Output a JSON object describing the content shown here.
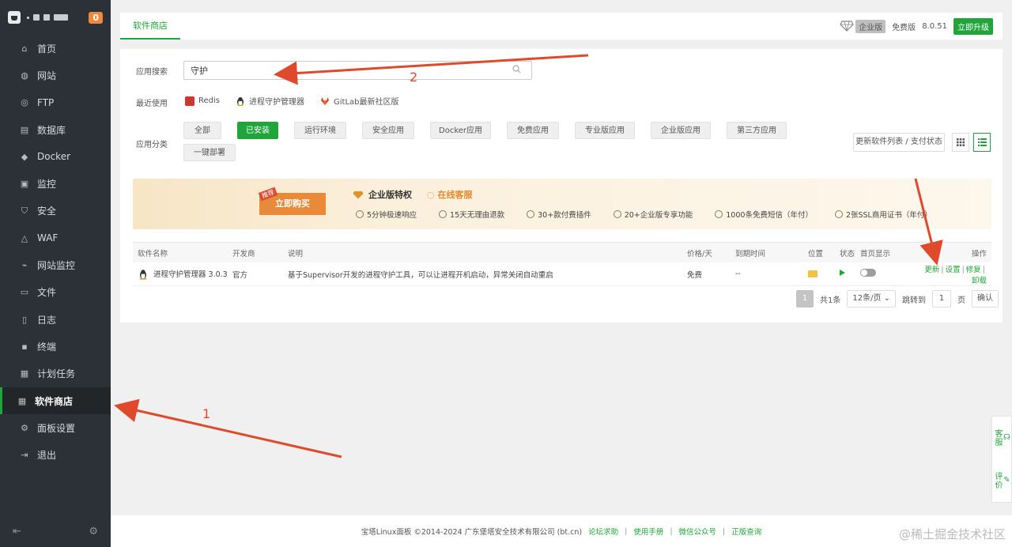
{
  "sidebar": {
    "badge": "0",
    "items": [
      {
        "label": "首页",
        "icon": "home-icon"
      },
      {
        "label": "网站",
        "icon": "globe-icon"
      },
      {
        "label": "FTP",
        "icon": "ftp-icon"
      },
      {
        "label": "数据库",
        "icon": "database-icon"
      },
      {
        "label": "Docker",
        "icon": "docker-icon"
      },
      {
        "label": "监控",
        "icon": "monitor-icon"
      },
      {
        "label": "安全",
        "icon": "shield-icon"
      },
      {
        "label": "WAF",
        "icon": "waf-icon"
      },
      {
        "label": "网站监控",
        "icon": "site-monitor-icon"
      },
      {
        "label": "文件",
        "icon": "folder-icon"
      },
      {
        "label": "日志",
        "icon": "log-icon"
      },
      {
        "label": "终端",
        "icon": "terminal-icon"
      },
      {
        "label": "计划任务",
        "icon": "task-icon"
      },
      {
        "label": "软件商店",
        "icon": "grid-icon"
      },
      {
        "label": "面板设置",
        "icon": "gear-icon"
      },
      {
        "label": "退出",
        "icon": "logout-icon"
      }
    ],
    "active_index": 13
  },
  "topbar": {
    "tab": "软件商店",
    "enterprise_label": "企业版",
    "free_label": "免费版",
    "version": "8.0.51",
    "upgrade_label": "立即升级"
  },
  "search": {
    "label": "应用搜索",
    "value": "守护"
  },
  "recent": {
    "label": "最近使用",
    "items": [
      "Redis",
      "进程守护管理器",
      "GitLab最新社区版"
    ]
  },
  "categories": {
    "label": "应用分类",
    "items": [
      "全部",
      "已安装",
      "运行环境",
      "安全应用",
      "Docker应用",
      "免费应用",
      "专业版应用",
      "企业版应用",
      "第三方应用",
      "一键部署"
    ],
    "active_index": 1,
    "refresh_label": "更新软件列表 / 支付状态"
  },
  "banner": {
    "tag": "推荐",
    "buy_label": "立即购买",
    "title": "企业版特权",
    "service": "在线客服",
    "features": [
      "5分钟极速响应",
      "15天无理由退款",
      "30+款付费插件",
      "20+企业版专享功能",
      "1000条免费短信（年付）",
      "2张SSL商用证书（年付）"
    ]
  },
  "table": {
    "headers": [
      "软件名称",
      "开发商",
      "说明",
      "价格/天",
      "到期时间",
      "位置",
      "状态",
      "首页显示",
      "操作"
    ],
    "rows": [
      {
        "name": "进程守护管理器 3.0.3",
        "developer": "官方",
        "description": "基于Supervisor开发的进程守护工具，可以让进程开机启动，异常关闭自动重启",
        "price": "免费",
        "expire": "--",
        "actions": [
          "更新",
          "设置",
          "修复",
          "卸载"
        ]
      }
    ]
  },
  "pager": {
    "current": "1",
    "total": "共1条",
    "per_page": "12条/页",
    "jump_label": "跳转到",
    "page_value": "1",
    "page_unit": "页",
    "confirm": "确认"
  },
  "footer": {
    "copyright": "宝塔Linux面板 ©2014-2024 广东堡塔安全技术有限公司 (bt.cn)",
    "links": [
      "论坛求助",
      "使用手册",
      "微信公众号",
      "正版查询"
    ]
  },
  "float_tools": [
    "客服",
    "评价"
  ],
  "annotations": [
    "1",
    "2"
  ],
  "watermark": "@稀土掘金技术社区",
  "colors": {
    "accent": "#20a53a",
    "sidebar_bg": "#2c3138",
    "arrow": "#e04a2c"
  }
}
